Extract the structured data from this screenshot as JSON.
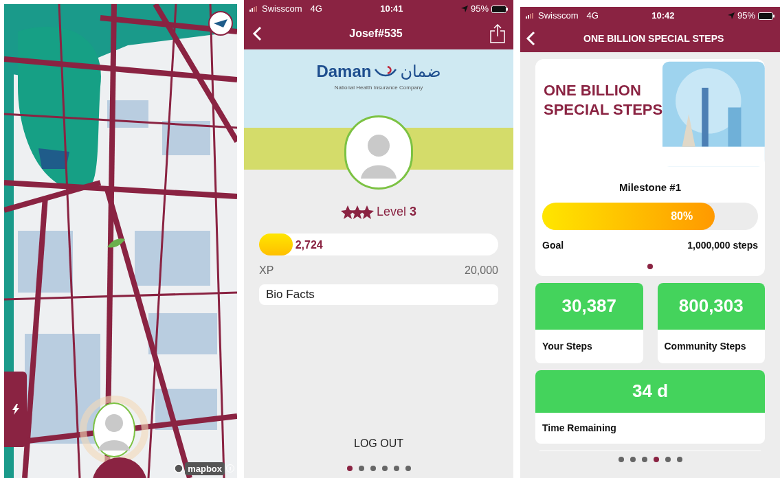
{
  "map_screen": {
    "attribution": "mapbox"
  },
  "profile_screen": {
    "status_bar": {
      "carrier": "Swisscom",
      "network": "4G",
      "time": "10:41",
      "battery": "95%"
    },
    "title": "Josef#535",
    "banner": {
      "brand": "Daman",
      "brand_arabic": "ضمان",
      "tagline": "National Health Insurance Company"
    },
    "level": "Level **3**",
    "xp": {
      "value": "2,724",
      "level": 0.14,
      "label": "XP",
      "max": "20,000"
    },
    "bio_facts": "Bio Facts",
    "logout": "LOG OUT",
    "pager": [
      {
        "selected": true
      },
      {
        "selected": false
      },
      {
        "selected": false
      },
      {
        "selected": false
      },
      {
        "selected": false
      },
      {
        "selected": false
      }
    ]
  },
  "steps_screen": {
    "status_bar": {
      "carrier": "Swisscom",
      "network": "4G",
      "time": "10:42",
      "battery": "95%"
    },
    "title": "ONE BILLION SPECIAL STEPS",
    "hero_title": [
      "ONE BILLION",
      "SPECIAL STEPS"
    ],
    "milestone": "Milestone #1",
    "progress": {
      "level": 0.8,
      "label": "80%"
    },
    "goal_label": "Goal",
    "goal_value": "1,000,000 steps",
    "card_pager": [
      {
        "selected": true
      }
    ],
    "stats": [
      {
        "value": "30,387",
        "label": "Your Steps"
      },
      {
        "value": "800,303",
        "label": "Community Steps"
      }
    ],
    "time": {
      "value": "34 d",
      "label": "Time Remaining"
    },
    "pager": [
      {
        "selected": false
      },
      {
        "selected": false
      },
      {
        "selected": false
      },
      {
        "selected": true
      },
      {
        "selected": false
      },
      {
        "selected": false
      }
    ]
  }
}
